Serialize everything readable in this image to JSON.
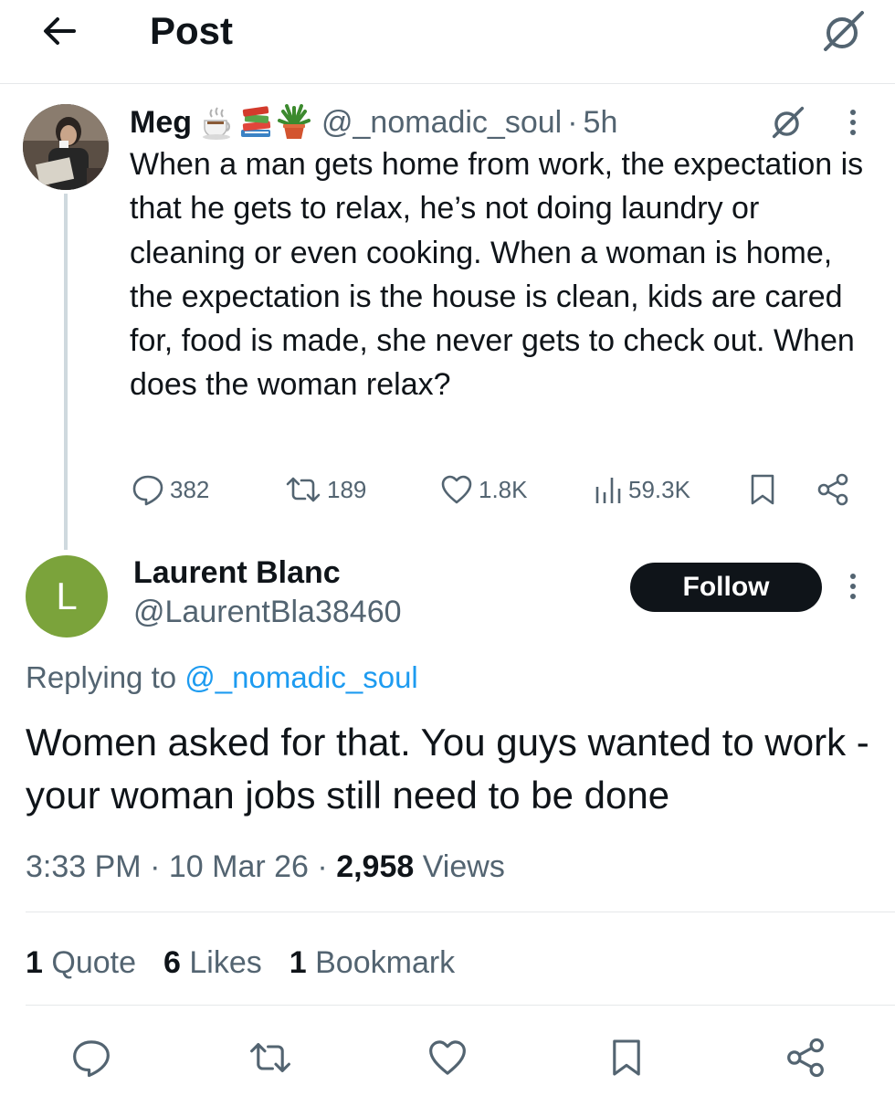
{
  "header": {
    "title": "Post",
    "back_icon": "arrow-left-icon",
    "grok_icon": "grok-icon"
  },
  "parent_tweet": {
    "author_name": "Meg",
    "author_emojis": [
      "hot-beverage-icon",
      "books-icon",
      "potted-plant-icon"
    ],
    "author_handle": "@_nomadic_soul",
    "separator": "·",
    "time": "5h",
    "text": "When a man gets home from work, the expectation is that he gets to relax, he’s not doing laundry or cleaning or even cooking. When a woman is home, the expectation is the house is clean, kids are cared for, food is made, she never gets to check out. When does the woman relax?",
    "replies": "382",
    "reposts": "189",
    "likes": "1.8K",
    "views": "59.3K"
  },
  "reply": {
    "avatar_letter": "L",
    "author_name": "Laurent Blanc",
    "author_handle": "@LaurentBla38460",
    "follow_label": "Follow",
    "replying_prefix": "Replying to",
    "replying_mention": "@_nomadic_soul",
    "text": "Women asked for that. You guys wanted to work - your woman jobs still need to be done",
    "time": "3:33 PM",
    "date": "10 Mar 26",
    "meta_sep": "·",
    "views_count": "2,958",
    "views_label": "Views",
    "quotes_count": "1",
    "quotes_label": "Quote",
    "likes_count": "6",
    "likes_label": "Likes",
    "bookmarks_count": "1",
    "bookmarks_label": "Bookmark"
  },
  "colors": {
    "text_primary": "#0f1419",
    "text_secondary": "#536471",
    "link": "#1d9bf0",
    "avatar_green": "#7ba33b",
    "divider": "#e6e8ea"
  }
}
